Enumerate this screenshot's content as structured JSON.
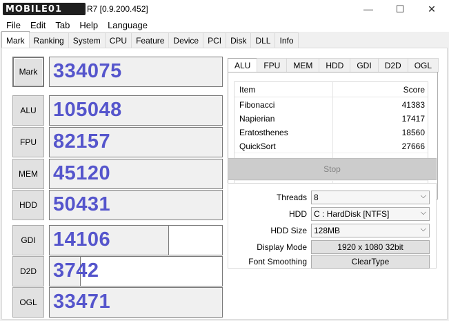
{
  "window": {
    "logo_text": "MOBILE01",
    "title_suffix": "R7 [0.9.200.452]",
    "minimize_glyph": "—",
    "maximize_glyph": "☐",
    "close_glyph": "✕"
  },
  "menu": [
    "File",
    "Edit",
    "Tab",
    "Help",
    "Language"
  ],
  "tabs": [
    "Mark",
    "Ranking",
    "System",
    "CPU",
    "Feature",
    "Device",
    "PCI",
    "Disk",
    "DLL",
    "Info"
  ],
  "scores": [
    {
      "label": "Mark",
      "value": "334075",
      "fill": 1.0
    },
    {
      "label": "ALU",
      "value": "105048",
      "fill": 1.0
    },
    {
      "label": "FPU",
      "value": "82157",
      "fill": 1.0
    },
    {
      "label": "MEM",
      "value": "45120",
      "fill": 1.0
    },
    {
      "label": "HDD",
      "value": "50431",
      "fill": 1.0
    },
    {
      "label": "GDI",
      "value": "14106",
      "fill": 0.69
    },
    {
      "label": "D2D",
      "value": "3742",
      "fill": 0.18
    },
    {
      "label": "OGL",
      "value": "33471",
      "fill": 1.0
    }
  ],
  "subtabs": [
    "ALU",
    "FPU",
    "MEM",
    "HDD",
    "GDI",
    "D2D",
    "OGL"
  ],
  "table": {
    "headers": [
      "Item",
      "Score"
    ],
    "rows": [
      [
        "Fibonacci",
        "41383"
      ],
      [
        "Napierian",
        "17417"
      ],
      [
        "Eratosthenes",
        "18560"
      ],
      [
        "QuickSort",
        "27666"
      ]
    ]
  },
  "stop_label": "Stop",
  "settings": [
    {
      "label": "Threads",
      "value": "8",
      "type": "select"
    },
    {
      "label": "HDD",
      "value": "C : HardDisk [NTFS]",
      "type": "select"
    },
    {
      "label": "HDD Size",
      "value": "128MB",
      "type": "select"
    },
    {
      "label": "Display Mode",
      "value": "1920 x 1080 32bit",
      "type": "button"
    },
    {
      "label": "Font Smoothing",
      "value": "ClearType",
      "type": "button"
    }
  ],
  "chevron_glyph": "⌵"
}
